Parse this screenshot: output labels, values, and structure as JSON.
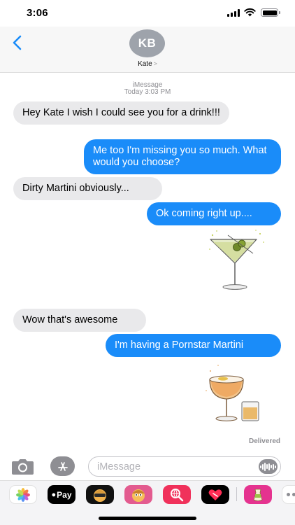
{
  "status_bar": {
    "time": "3:06"
  },
  "header": {
    "avatar_initials": "KB",
    "contact_name": "Kate",
    "contact_chevron": ">"
  },
  "thread": {
    "service": "iMessage",
    "timestamp": "Today 3:03 PM",
    "messages": [
      {
        "direction": "incoming",
        "text": "Hey Kate I wish I could see you for a drink!!!"
      },
      {
        "direction": "outgoing",
        "text": "Me too I'm missing you so much. What would you choose?"
      },
      {
        "direction": "incoming",
        "text": "Dirty Martini obviously..."
      },
      {
        "direction": "outgoing",
        "text": "Ok coming right up...."
      },
      {
        "direction": "outgoing",
        "sticker": "martini-glass-sticker"
      },
      {
        "direction": "incoming",
        "text": "Wow that's awesome"
      },
      {
        "direction": "outgoing",
        "text": "I'm having a Pornstar Martini"
      },
      {
        "direction": "outgoing",
        "sticker": "pornstar-martini-sticker"
      }
    ],
    "status": "Delivered"
  },
  "composer": {
    "placeholder": "iMessage"
  },
  "app_drawer": {
    "apps": [
      {
        "icon": "photos-icon"
      },
      {
        "icon": "apple-pay-icon",
        "label": "Pay"
      },
      {
        "icon": "memoji-icon"
      },
      {
        "icon": "animoji-icon"
      },
      {
        "icon": "web-search-icon"
      },
      {
        "icon": "digital-touch-icon"
      },
      {
        "icon": "sticker-pack-icon"
      },
      {
        "icon": "more-apps-icon"
      }
    ]
  },
  "colors": {
    "outgoing_bubble": "#1a8cf9",
    "incoming_bubble": "#e9e9eb",
    "accent": "#007aff"
  }
}
